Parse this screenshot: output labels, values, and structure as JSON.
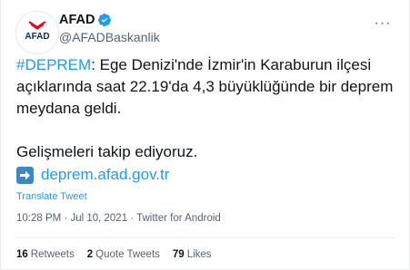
{
  "tweet": {
    "display_name": "AFAD",
    "handle": "@AFADBaskanlik",
    "avatar_text": "AFAD",
    "hashtag": "#DEPREM",
    "text_line1": ": Ege Denizi'nde İzmir'in Karaburun ilçesi",
    "text_line2": "açıklarında saat 22.19'da 4,3 büyüklüğünde bir deprem",
    "text_line3": "meydana geldi.",
    "text_para2": "Gelişmeleri takip ediyoruz.",
    "link": "deprem.afad.gov.tr",
    "translate_label": "Translate Tweet",
    "timestamp": "10:28 PM · Jul 10, 2021 · Twitter for Android",
    "stats": {
      "retweets_count": "16",
      "retweets_label": "Retweets",
      "quotes_count": "2",
      "quotes_label": "Quote Tweets",
      "likes_count": "79",
      "likes_label": "Likes"
    }
  },
  "colors": {
    "link_blue": "#1d9bf0",
    "verified_blue": "#1d9bf0",
    "secondary_text": "#536471",
    "afad_red": "#e30a17",
    "afad_navy": "#0c2a5b",
    "arrow_box": "#3b88c3"
  },
  "icons": {
    "verified": "verified-badge-icon",
    "more": "more-options-icon",
    "link_arrow": "right-arrow-icon"
  }
}
